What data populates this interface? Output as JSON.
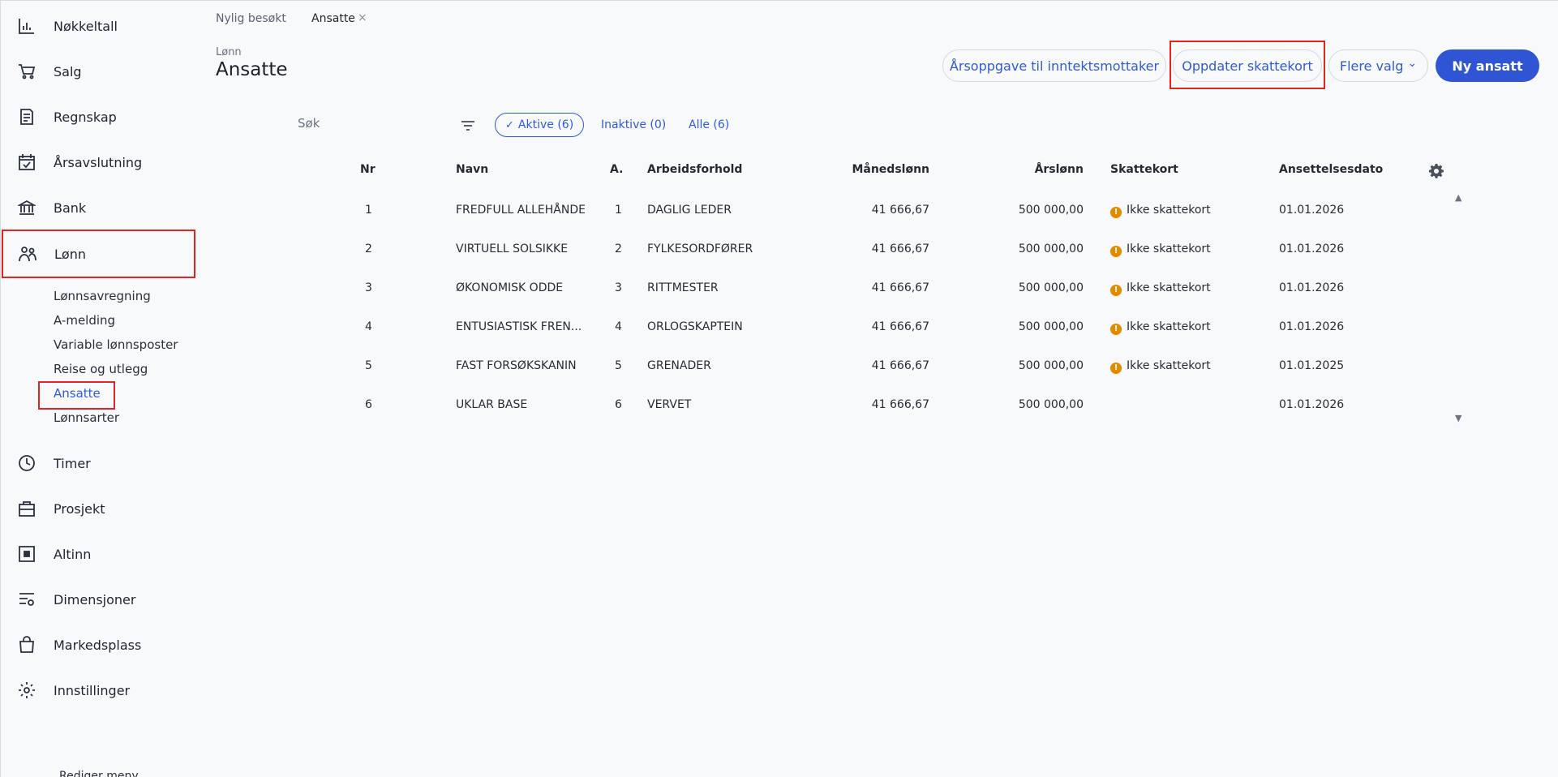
{
  "sidebar": {
    "items": [
      {
        "label": "Nøkkeltall",
        "icon": "chart-bar-icon"
      },
      {
        "label": "Salg",
        "icon": "cart-icon"
      },
      {
        "label": "Regnskap",
        "icon": "ledger-icon"
      },
      {
        "label": "Årsavslutning",
        "icon": "calendar-check-icon"
      },
      {
        "label": "Bank",
        "icon": "bank-icon"
      },
      {
        "label": "Lønn",
        "icon": "people-icon"
      },
      {
        "label": "Timer",
        "icon": "clock-icon"
      },
      {
        "label": "Prosjekt",
        "icon": "briefcase-icon"
      },
      {
        "label": "Altinn",
        "icon": "altinn-icon"
      },
      {
        "label": "Dimensjoner",
        "icon": "dimensions-icon"
      },
      {
        "label": "Markedsplass",
        "icon": "shopping-bag-icon"
      },
      {
        "label": "Innstillinger",
        "icon": "gear-icon"
      }
    ],
    "sub_items": [
      "Lønnsavregning",
      "A-melding",
      "Variable lønnsposter",
      "Reise og utlegg",
      "Ansatte",
      "Lønnsarter"
    ],
    "edit_menu": "Rediger meny"
  },
  "tabs": {
    "recent": "Nylig besøkt",
    "current": "Ansatte",
    "close": "×"
  },
  "header": {
    "breadcrumb": "Lønn",
    "title": "Ansatte"
  },
  "actions": {
    "annual_statement": "Årsoppgave til inntektsmottaker",
    "update_tax_card": "Oppdater skattekort",
    "more_options": "Flere valg",
    "more_chevron": "⌄",
    "new_employee": "Ny ansatt"
  },
  "filters": {
    "search_placeholder": "Søk",
    "active": "Aktive (6)",
    "inactive": "Inaktive (0)",
    "all": "Alle (6)",
    "check": "✓"
  },
  "table": {
    "headers": {
      "nr": "Nr",
      "name": "Navn",
      "a": "A.",
      "employment": "Arbeidsforhold",
      "monthly": "Månedslønn",
      "yearly": "Årslønn",
      "taxcard": "Skattekort",
      "date": "Ansettelsesdato"
    },
    "rows": [
      {
        "nr": "1",
        "name": "FREDFULL ALLEHÅNDE",
        "a": "1",
        "employment": "DAGLIG LEDER",
        "monthly": "41 666,67",
        "yearly": "500 000,00",
        "taxcard": "Ikke skattekort",
        "date": "01.01.2026"
      },
      {
        "nr": "2",
        "name": "VIRTUELL SOLSIKKE",
        "a": "2",
        "employment": "FYLKESORDFØRER",
        "monthly": "41 666,67",
        "yearly": "500 000,00",
        "taxcard": "Ikke skattekort",
        "date": "01.01.2026"
      },
      {
        "nr": "3",
        "name": "ØKONOMISK ODDE",
        "a": "3",
        "employment": "RITTMESTER",
        "monthly": "41 666,67",
        "yearly": "500 000,00",
        "taxcard": "Ikke skattekort",
        "date": "01.01.2026"
      },
      {
        "nr": "4",
        "name": "ENTUSIASTISK FREN...",
        "a": "4",
        "employment": "ORLOGSKAPTEIN",
        "monthly": "41 666,67",
        "yearly": "500 000,00",
        "taxcard": "Ikke skattekort",
        "date": "01.01.2026"
      },
      {
        "nr": "5",
        "name": "FAST FORSØKSKANIN",
        "a": "5",
        "employment": "GRENADER",
        "monthly": "41 666,67",
        "yearly": "500 000,00",
        "taxcard": "Ikke skattekort",
        "date": "01.01.2025"
      },
      {
        "nr": "6",
        "name": "UKLAR BASE",
        "a": "6",
        "employment": "VERVET",
        "monthly": "41 666,67",
        "yearly": "500 000,00",
        "taxcard": "",
        "date": "01.01.2026"
      }
    ]
  },
  "colors": {
    "accent": "#2f55d4",
    "highlight": "#e02424",
    "warning": "#e28a00"
  }
}
